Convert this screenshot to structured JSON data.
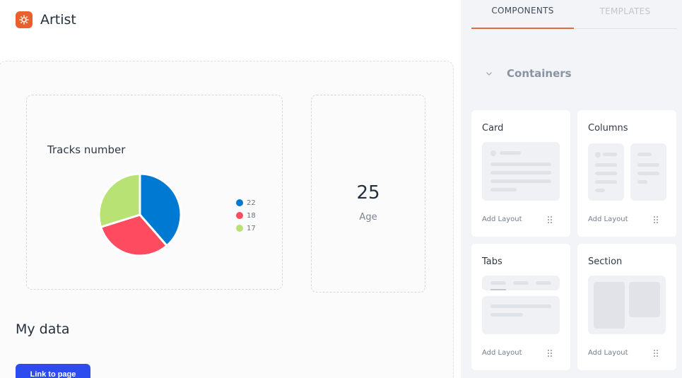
{
  "app": {
    "name": "Artist",
    "logo_color": "#e8612c",
    "logo_icon": "gear-icon"
  },
  "canvas": {
    "chart_widget": {
      "title": "Tracks number",
      "legend": [
        {
          "label": "22",
          "color": "#0079d2"
        },
        {
          "label": "18",
          "color": "#ff4b5f"
        },
        {
          "label": "17",
          "color": "#b9e274"
        }
      ]
    },
    "stat_widget": {
      "value": "25",
      "label": "Age"
    },
    "section_heading": "My data",
    "link_button_label": "Link to page"
  },
  "chart_data": {
    "type": "pie",
    "title": "Tracks number",
    "categories": [
      "22",
      "18",
      "17"
    ],
    "values": [
      22,
      18,
      17
    ],
    "colors": [
      "#0079d2",
      "#ff4b5f",
      "#b9e274"
    ],
    "legend_position": "right"
  },
  "panel": {
    "tabs": [
      {
        "label": "COMPONENTS",
        "active": true
      },
      {
        "label": "TEMPLATES",
        "active": false
      }
    ],
    "group": {
      "title": "Containers",
      "expanded": true
    },
    "cards": [
      {
        "title": "Card",
        "action": "Add Layout"
      },
      {
        "title": "Columns",
        "action": "Add Layout"
      },
      {
        "title": "Tabs",
        "action": "Add Layout"
      },
      {
        "title": "Section",
        "action": "Add Layout"
      }
    ],
    "accent_color": "#e36a3e"
  }
}
